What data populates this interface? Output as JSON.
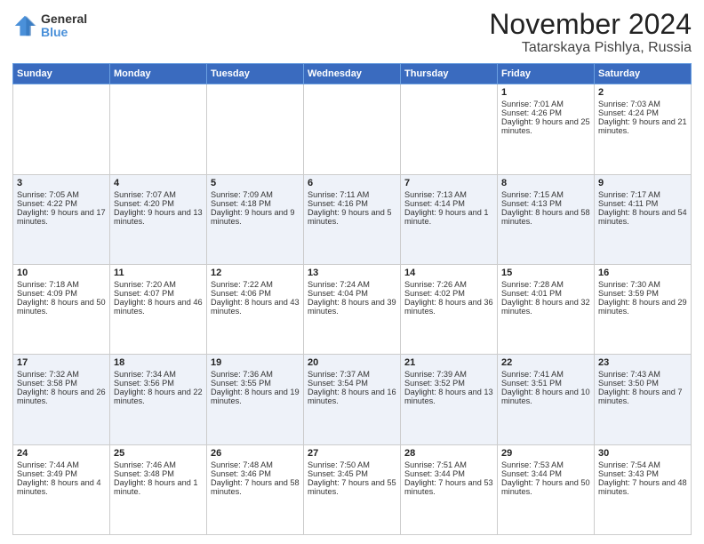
{
  "logo": {
    "general": "General",
    "blue": "Blue"
  },
  "header": {
    "month": "November 2024",
    "location": "Tatarskaya Pishlya, Russia"
  },
  "weekdays": [
    "Sunday",
    "Monday",
    "Tuesday",
    "Wednesday",
    "Thursday",
    "Friday",
    "Saturday"
  ],
  "weeks": [
    [
      {
        "day": "",
        "data": ""
      },
      {
        "day": "",
        "data": ""
      },
      {
        "day": "",
        "data": ""
      },
      {
        "day": "",
        "data": ""
      },
      {
        "day": "",
        "data": ""
      },
      {
        "day": "1",
        "data": "Sunrise: 7:01 AM\nSunset: 4:26 PM\nDaylight: 9 hours and 25 minutes."
      },
      {
        "day": "2",
        "data": "Sunrise: 7:03 AM\nSunset: 4:24 PM\nDaylight: 9 hours and 21 minutes."
      }
    ],
    [
      {
        "day": "3",
        "data": "Sunrise: 7:05 AM\nSunset: 4:22 PM\nDaylight: 9 hours and 17 minutes."
      },
      {
        "day": "4",
        "data": "Sunrise: 7:07 AM\nSunset: 4:20 PM\nDaylight: 9 hours and 13 minutes."
      },
      {
        "day": "5",
        "data": "Sunrise: 7:09 AM\nSunset: 4:18 PM\nDaylight: 9 hours and 9 minutes."
      },
      {
        "day": "6",
        "data": "Sunrise: 7:11 AM\nSunset: 4:16 PM\nDaylight: 9 hours and 5 minutes."
      },
      {
        "day": "7",
        "data": "Sunrise: 7:13 AM\nSunset: 4:14 PM\nDaylight: 9 hours and 1 minute."
      },
      {
        "day": "8",
        "data": "Sunrise: 7:15 AM\nSunset: 4:13 PM\nDaylight: 8 hours and 58 minutes."
      },
      {
        "day": "9",
        "data": "Sunrise: 7:17 AM\nSunset: 4:11 PM\nDaylight: 8 hours and 54 minutes."
      }
    ],
    [
      {
        "day": "10",
        "data": "Sunrise: 7:18 AM\nSunset: 4:09 PM\nDaylight: 8 hours and 50 minutes."
      },
      {
        "day": "11",
        "data": "Sunrise: 7:20 AM\nSunset: 4:07 PM\nDaylight: 8 hours and 46 minutes."
      },
      {
        "day": "12",
        "data": "Sunrise: 7:22 AM\nSunset: 4:06 PM\nDaylight: 8 hours and 43 minutes."
      },
      {
        "day": "13",
        "data": "Sunrise: 7:24 AM\nSunset: 4:04 PM\nDaylight: 8 hours and 39 minutes."
      },
      {
        "day": "14",
        "data": "Sunrise: 7:26 AM\nSunset: 4:02 PM\nDaylight: 8 hours and 36 minutes."
      },
      {
        "day": "15",
        "data": "Sunrise: 7:28 AM\nSunset: 4:01 PM\nDaylight: 8 hours and 32 minutes."
      },
      {
        "day": "16",
        "data": "Sunrise: 7:30 AM\nSunset: 3:59 PM\nDaylight: 8 hours and 29 minutes."
      }
    ],
    [
      {
        "day": "17",
        "data": "Sunrise: 7:32 AM\nSunset: 3:58 PM\nDaylight: 8 hours and 26 minutes."
      },
      {
        "day": "18",
        "data": "Sunrise: 7:34 AM\nSunset: 3:56 PM\nDaylight: 8 hours and 22 minutes."
      },
      {
        "day": "19",
        "data": "Sunrise: 7:36 AM\nSunset: 3:55 PM\nDaylight: 8 hours and 19 minutes."
      },
      {
        "day": "20",
        "data": "Sunrise: 7:37 AM\nSunset: 3:54 PM\nDaylight: 8 hours and 16 minutes."
      },
      {
        "day": "21",
        "data": "Sunrise: 7:39 AM\nSunset: 3:52 PM\nDaylight: 8 hours and 13 minutes."
      },
      {
        "day": "22",
        "data": "Sunrise: 7:41 AM\nSunset: 3:51 PM\nDaylight: 8 hours and 10 minutes."
      },
      {
        "day": "23",
        "data": "Sunrise: 7:43 AM\nSunset: 3:50 PM\nDaylight: 8 hours and 7 minutes."
      }
    ],
    [
      {
        "day": "24",
        "data": "Sunrise: 7:44 AM\nSunset: 3:49 PM\nDaylight: 8 hours and 4 minutes."
      },
      {
        "day": "25",
        "data": "Sunrise: 7:46 AM\nSunset: 3:48 PM\nDaylight: 8 hours and 1 minute."
      },
      {
        "day": "26",
        "data": "Sunrise: 7:48 AM\nSunset: 3:46 PM\nDaylight: 7 hours and 58 minutes."
      },
      {
        "day": "27",
        "data": "Sunrise: 7:50 AM\nSunset: 3:45 PM\nDaylight: 7 hours and 55 minutes."
      },
      {
        "day": "28",
        "data": "Sunrise: 7:51 AM\nSunset: 3:44 PM\nDaylight: 7 hours and 53 minutes."
      },
      {
        "day": "29",
        "data": "Sunrise: 7:53 AM\nSunset: 3:44 PM\nDaylight: 7 hours and 50 minutes."
      },
      {
        "day": "30",
        "data": "Sunrise: 7:54 AM\nSunset: 3:43 PM\nDaylight: 7 hours and 48 minutes."
      }
    ]
  ]
}
